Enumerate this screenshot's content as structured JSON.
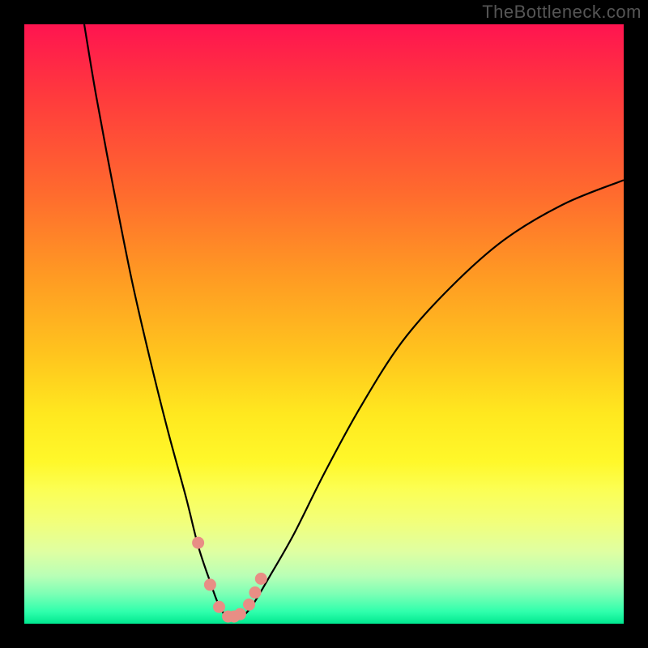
{
  "watermark": "TheBottleneck.com",
  "chart_data": {
    "type": "line",
    "title": "",
    "xlabel": "",
    "ylabel": "",
    "xlim": [
      0,
      100
    ],
    "ylim": [
      0,
      100
    ],
    "series": [
      {
        "name": "curve",
        "color": "#000000",
        "x": [
          10,
          12,
          15,
          18,
          21,
          24,
          27,
          29,
          31,
          32.5,
          34,
          36,
          38,
          41,
          45,
          50,
          56,
          63,
          71,
          80,
          90,
          100
        ],
        "values": [
          100,
          88,
          72,
          57,
          44,
          32,
          21,
          13,
          7,
          3,
          1,
          1,
          3,
          8,
          15,
          25,
          36,
          47,
          56,
          64,
          70,
          74
        ]
      }
    ],
    "markers": {
      "name": "dip-markers",
      "color": "#e88e85",
      "x": [
        29,
        31,
        32.5,
        34,
        35,
        36,
        37.5,
        38.5,
        39.5
      ],
      "values": [
        13.5,
        6.5,
        2.8,
        1.2,
        1.2,
        1.6,
        3.2,
        5.2,
        7.5
      ]
    },
    "gradient_stops": [
      {
        "pos": 0.0,
        "color": "#ff1450"
      },
      {
        "pos": 0.12,
        "color": "#ff3a3d"
      },
      {
        "pos": 0.28,
        "color": "#ff6a2e"
      },
      {
        "pos": 0.42,
        "color": "#ff9a23"
      },
      {
        "pos": 0.55,
        "color": "#ffc41e"
      },
      {
        "pos": 0.65,
        "color": "#ffe81f"
      },
      {
        "pos": 0.73,
        "color": "#fff82a"
      },
      {
        "pos": 0.78,
        "color": "#fbff57"
      },
      {
        "pos": 0.83,
        "color": "#f2ff7a"
      },
      {
        "pos": 0.88,
        "color": "#dfffa2"
      },
      {
        "pos": 0.92,
        "color": "#b9ffb6"
      },
      {
        "pos": 0.95,
        "color": "#7dffb5"
      },
      {
        "pos": 0.98,
        "color": "#2fffac"
      },
      {
        "pos": 1.0,
        "color": "#00e890"
      }
    ]
  }
}
